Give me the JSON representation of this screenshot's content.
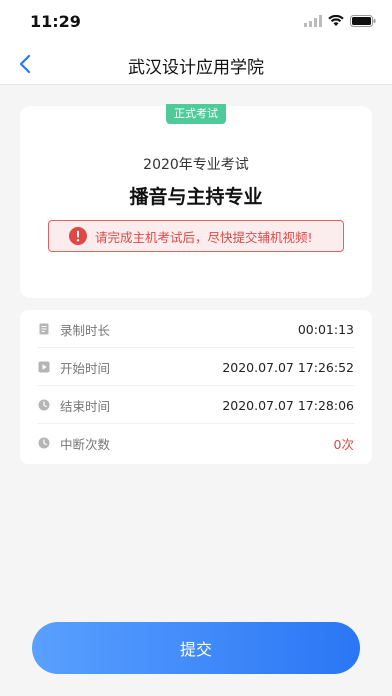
{
  "status_bar": {
    "time": "11:29"
  },
  "nav": {
    "title": "武汉设计应用学院"
  },
  "exam": {
    "badge": "正式考试",
    "year_title": "2020年专业考试",
    "major": "播音与主持专业",
    "warning": "请完成主机考试后，尽快提交辅机视频!"
  },
  "info": {
    "rows": [
      {
        "label": "录制时长",
        "value": "00:01:13",
        "icon": "document-icon"
      },
      {
        "label": "开始时间",
        "value": "2020.07.07 17:26:52",
        "icon": "play-icon"
      },
      {
        "label": "结束时间",
        "value": "2020.07.07 17:28:06",
        "icon": "clock-icon"
      },
      {
        "label": "中断次数",
        "value": "0次",
        "icon": "clock-icon"
      }
    ]
  },
  "submit": {
    "label": "提交"
  },
  "colors": {
    "accent": "#2a76f5",
    "badge": "#4fcb9a",
    "warning": "#e04848"
  }
}
